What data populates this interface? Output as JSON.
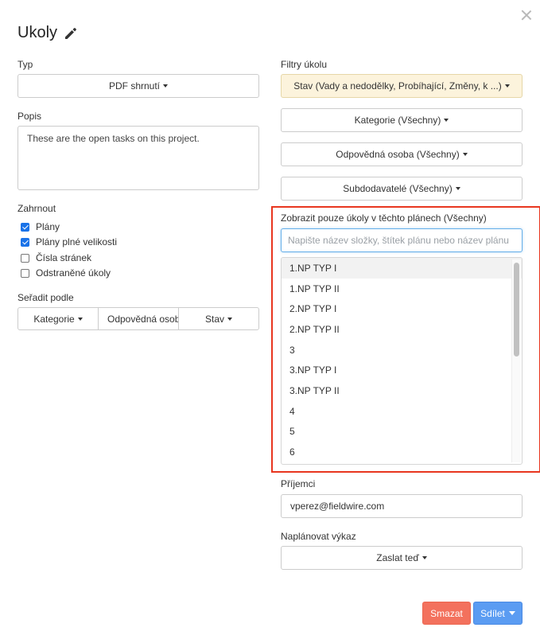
{
  "modal": {
    "title": "Ukoly",
    "close_icon": "close-icon",
    "edit_icon": "pencil-icon"
  },
  "left": {
    "type_label": "Typ",
    "type_value": "PDF shrnutí",
    "description_label": "Popis",
    "description_value": "These are the open tasks on this project.",
    "include_label": "Zahrnout",
    "include_options": [
      {
        "label": "Plány",
        "checked": true
      },
      {
        "label": "Plány plné velikosti",
        "checked": true
      },
      {
        "label": "Čísla stránek",
        "checked": false
      },
      {
        "label": "Odstraněné úkoly",
        "checked": false
      }
    ],
    "sort_label": "Seřadit podle",
    "sort_buttons": [
      "Kategorie",
      "Odpovědná osoba",
      "Stav"
    ]
  },
  "right": {
    "filters_label": "Filtry úkolu",
    "filter_buttons": [
      "Stav (Vady a nedodělky, Probíhající, Změny, k ...)",
      "Kategorie (Všechny)",
      "Odpovědná osoba (Všechny)",
      "Subdodavatelé (Všechny)"
    ],
    "plans_filter_label": "Zobrazit pouze úkoly v těchto plánech (Všechny)",
    "plans_search_placeholder": "Napište název složky, štítek plánu nebo název plánu",
    "plans_list": [
      "1.NP TYP I",
      "1.NP TYP II",
      "2.NP TYP I",
      "2.NP TYP II",
      "3",
      "3.NP TYP I",
      "3.NP TYP II",
      "4",
      "5",
      "6"
    ],
    "recipients_label": "Příjemci",
    "recipients_value": "vperez@fieldwire.com",
    "schedule_label": "Naplánovat výkaz",
    "schedule_value": "Zaslat teď"
  },
  "footer": {
    "delete_label": "Smazat",
    "share_label": "Sdílet"
  },
  "colors": {
    "highlight_frame": "#e8361f",
    "status_filter_bg": "#fcf3dc",
    "delete_button": "#f3715d",
    "share_button": "#5b9cf2",
    "checkbox_checked": "#1a73e8"
  }
}
